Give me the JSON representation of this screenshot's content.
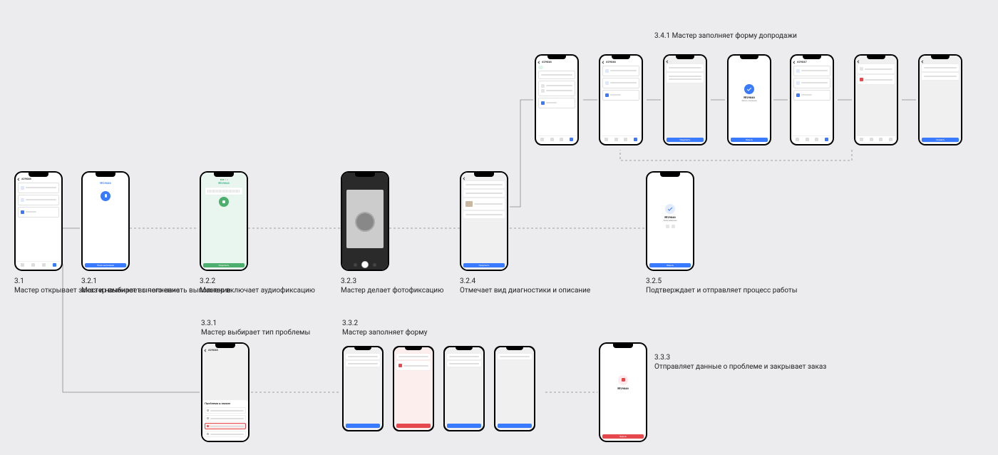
{
  "labels": {
    "s31_num": "3.1",
    "s31_text": "Мастер открывает заказ и начинает выполнение",
    "s321_num": "3.2.1",
    "s321_text": "Мастер выбирает с чего начать выполнение",
    "s322_num": "3.2.2",
    "s322_text": "Мастер включает аудиофиксацию",
    "s323_num": "3.2.3",
    "s323_text": "Мастер делает фотофиксацию",
    "s324_num": "3.2.4",
    "s324_text": "Отмечает вид диагностики и описание",
    "s325_num": "3.2.5",
    "s325_text": "Подтверждает и отправляет процесс работы",
    "s331_num": "3.3.1",
    "s331_text": "Мастер выбирает тип проблемы",
    "s332_num": "3.3.2",
    "s332_text": "Мастер заполняет форму",
    "s333_num": "3.3.3",
    "s333_text": "Отправляет данные о проблеме и закрывает заказ",
    "s341_num": "3.4.1",
    "s341_text": "Мастер заполняет форму допродажи"
  },
  "order": {
    "id_46": "#29046",
    "id_46_n": "№29046",
    "id_47": "#29047",
    "id_48": "#29048",
    "id_48_n": "№29048"
  },
  "buttons": {
    "start": "Начать выполнение",
    "continue": "Продолжить",
    "send": "Отправить",
    "close": "Закрыть",
    "cancel": "Отмена"
  },
  "sheet_title": "Проблема в заказе",
  "status_done": "Заказ завершен",
  "status_recorded": "Запись сохранена"
}
